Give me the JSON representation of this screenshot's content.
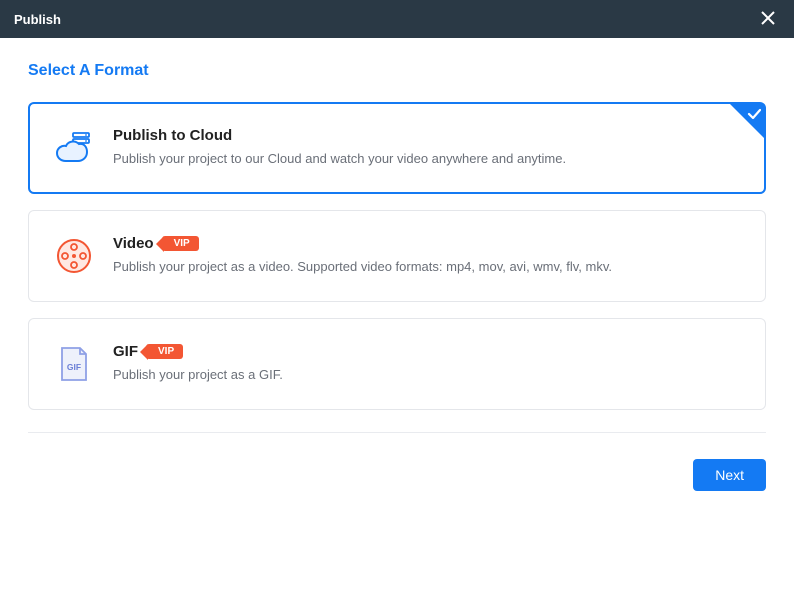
{
  "titlebar": {
    "title": "Publish"
  },
  "heading": "Select A Format",
  "options": {
    "cloud": {
      "title": "Publish to Cloud",
      "desc": "Publish your project to our Cloud and watch your video anywhere and anytime."
    },
    "video": {
      "title": "Video",
      "vip": "VIP",
      "desc": "Publish your project as a video. Supported video formats: mp4, mov, avi, wmv, flv, mkv."
    },
    "gif": {
      "title": "GIF",
      "vip": "VIP",
      "gifLabel": "GIF",
      "desc": "Publish your project as a GIF."
    }
  },
  "footer": {
    "next": "Next"
  },
  "colors": {
    "accent": "#147af3",
    "vip": "#f35633"
  }
}
